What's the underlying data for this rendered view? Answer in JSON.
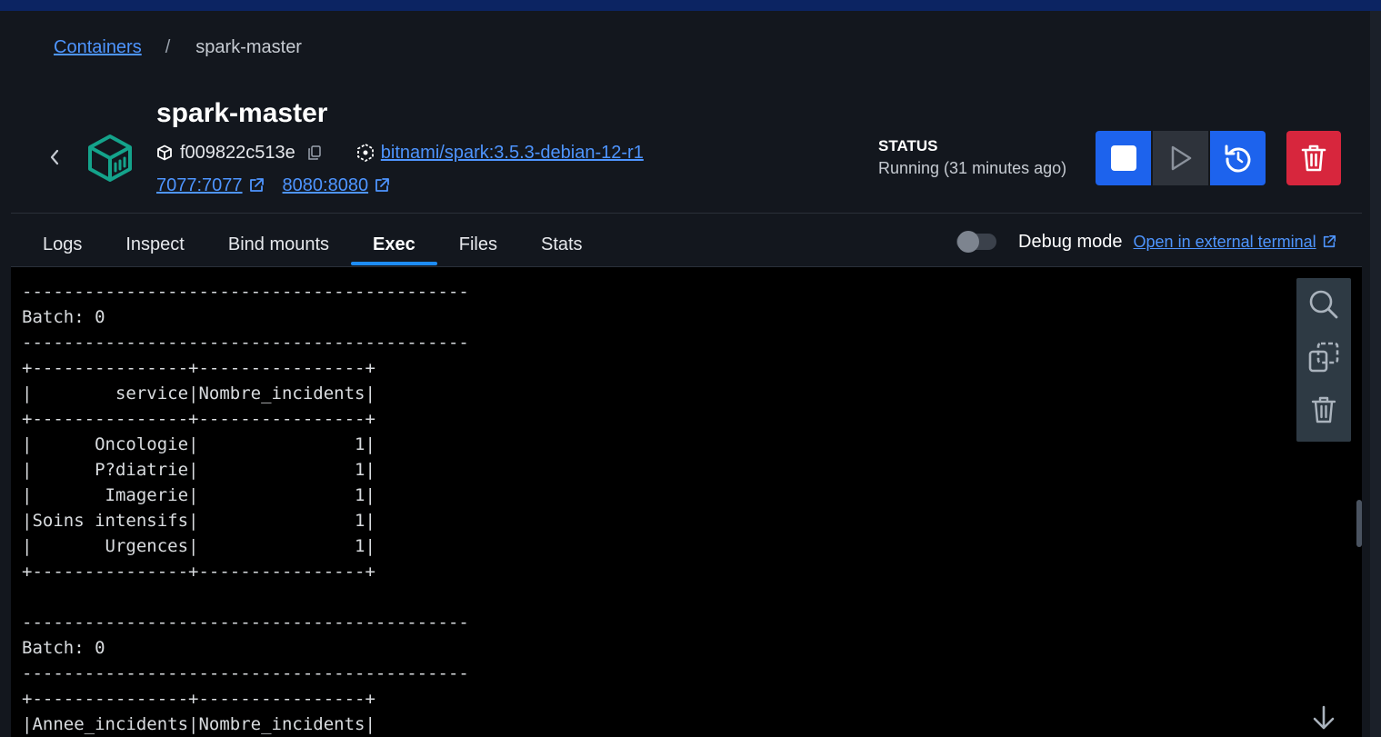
{
  "breadcrumb": {
    "root": "Containers",
    "separator": "/",
    "current": "spark-master"
  },
  "container": {
    "name": "spark-master",
    "id": "f009822c513e",
    "image": "bitnami/spark:3.5.3-debian-12-r1",
    "ports": [
      "7077:7077",
      "8080:8080"
    ]
  },
  "status": {
    "label": "STATUS",
    "text": "Running (31 minutes ago)"
  },
  "tabs": [
    {
      "label": "Logs"
    },
    {
      "label": "Inspect"
    },
    {
      "label": "Bind mounts"
    },
    {
      "label": "Exec",
      "active": true
    },
    {
      "label": "Files"
    },
    {
      "label": "Stats"
    }
  ],
  "debug": {
    "label": "Debug mode",
    "external_link": "Open in external terminal"
  },
  "terminal": {
    "lines": [
      "-------------------------------------------",
      "Batch: 0",
      "-------------------------------------------",
      "+---------------+----------------+",
      "|        service|Nombre_incidents|",
      "+---------------+----------------+",
      "|      Oncologie|               1|",
      "|      P?diatrie|               1|",
      "|       Imagerie|               1|",
      "|Soins intensifs|               1|",
      "|       Urgences|               1|",
      "+---------------+----------------+",
      "",
      "-------------------------------------------",
      "Batch: 0",
      "-------------------------------------------",
      "+---------------+----------------+",
      "|Annee_incidents|Nombre_incidents|"
    ]
  },
  "icons": {
    "back": "chevron-left-icon",
    "container": "container-cube-icon",
    "id": "cube-icon",
    "copy": "copy-icon",
    "image": "image-layers-icon",
    "external": "external-link-icon",
    "stop": "stop-icon",
    "start": "play-icon",
    "restart": "restart-icon",
    "delete": "trash-icon",
    "search": "search-icon",
    "copy_select": "copy-selection-icon",
    "clear": "trash-icon",
    "scroll_down": "arrow-down-icon"
  },
  "colors": {
    "accent": "#1d63ed",
    "link": "#4e95ff",
    "danger": "#d7263d",
    "container_icon": "#14a38b",
    "background": "#13171e",
    "terminal_bg": "#000000"
  }
}
